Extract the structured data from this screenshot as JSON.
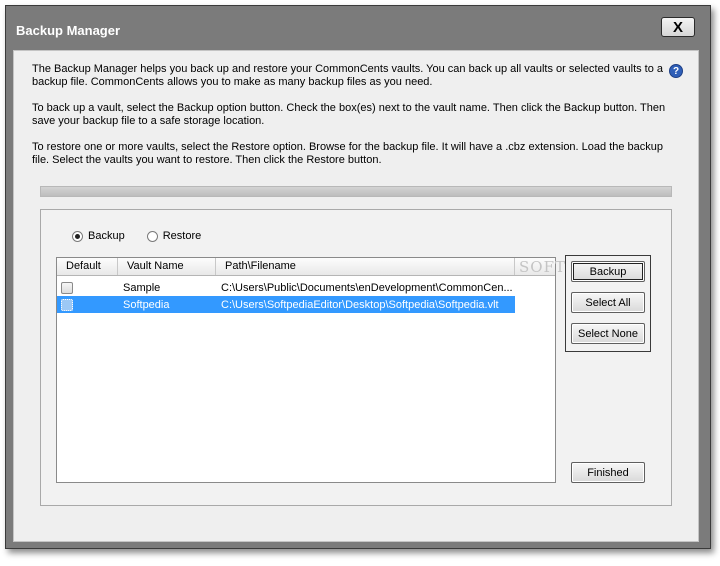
{
  "window": {
    "title": "Backup Manager",
    "close_label": "X",
    "help_label": "?"
  },
  "instructions": {
    "p1": "The Backup Manager helps you back up and restore your CommonCents vaults. You can back up all vaults or selected vaults to a backup file. CommonCents allows you to make as many backup files as you need.",
    "p2": "To back up a vault, select the Backup option button. Check the box(es) next to the vault name. Then click the Backup button. Then save your backup file to a safe storage location.",
    "p3": "To restore one or more vaults, select the Restore option. Browse for the backup file. It will have a .cbz extension. Load the backup file. Select the vaults you want to restore. Then click the Restore button."
  },
  "progress": {
    "value": 0
  },
  "mode": {
    "backup_label": "Backup",
    "restore_label": "Restore",
    "selected": "backup"
  },
  "vault_list": {
    "columns": [
      "Default",
      "Vault Name",
      "Path\\Filename",
      ""
    ],
    "rows": [
      {
        "default": false,
        "name": "Sample",
        "path": "C:\\Users\\Public\\Documents\\enDevelopment\\CommonCen...",
        "selected": false
      },
      {
        "default": false,
        "name": "Softpedia",
        "path": "C:\\Users\\SoftpediaEditor\\Desktop\\Softpedia\\Softpedia.vlt",
        "selected": true
      }
    ]
  },
  "watermark": "SOFTPEDIA",
  "buttons": {
    "backup": "Backup",
    "select_all": "Select All",
    "select_none": "Select None",
    "finished": "Finished"
  },
  "colors": {
    "selection": "#3399ff",
    "window_frame": "#7b7b7b",
    "content_bg": "#efefef"
  }
}
